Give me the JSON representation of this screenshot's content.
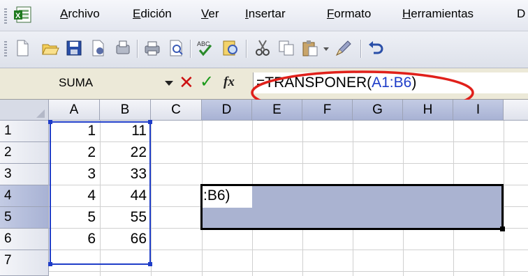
{
  "menu": {
    "items": [
      {
        "label": "Archivo",
        "u": "A",
        "rest": "rchivo"
      },
      {
        "label": "Edición",
        "u": "E",
        "rest": "dición"
      },
      {
        "label": "Ver",
        "u": "V",
        "rest": "er"
      },
      {
        "label": "Insertar",
        "u": "I",
        "rest": "nsertar"
      },
      {
        "label": "Formato",
        "u": "F",
        "rest": "ormato"
      },
      {
        "label": "Herramientas",
        "u": "H",
        "rest": "erramientas"
      },
      {
        "label": "D",
        "u": "D",
        "rest": ""
      }
    ]
  },
  "toolbar": {
    "icons": [
      "new-icon",
      "open-icon",
      "save-icon",
      "permission-icon",
      "print-preview-icon",
      "print-icon",
      "preview-icon",
      "spelling-icon",
      "research-icon",
      "cut-icon",
      "copy-icon",
      "paste-icon",
      "format-painter-icon",
      "undo-icon"
    ]
  },
  "formula_bar": {
    "name_box": "SUMA",
    "cancel": "✕",
    "enter": "✓",
    "fx": "fx",
    "formula_prefix": "=TRANSPONER(",
    "formula_ref": "A1:B6",
    "formula_suffix": ")"
  },
  "sheet": {
    "columns": [
      "A",
      "B",
      "C",
      "D",
      "E",
      "F",
      "G",
      "H",
      "I"
    ],
    "rows": [
      "1",
      "2",
      "3",
      "4",
      "5",
      "6",
      "7"
    ],
    "col_a": [
      "1",
      "2",
      "3",
      "4",
      "5",
      "6"
    ],
    "col_b": [
      "11",
      "22",
      "33",
      "44",
      "55",
      "66"
    ],
    "active_cell_text": ":B6)"
  },
  "colors": {
    "reference_blue": "#1f3dc8",
    "selection_fill": "#aab3d1",
    "annotation_red": "#e0201a"
  }
}
